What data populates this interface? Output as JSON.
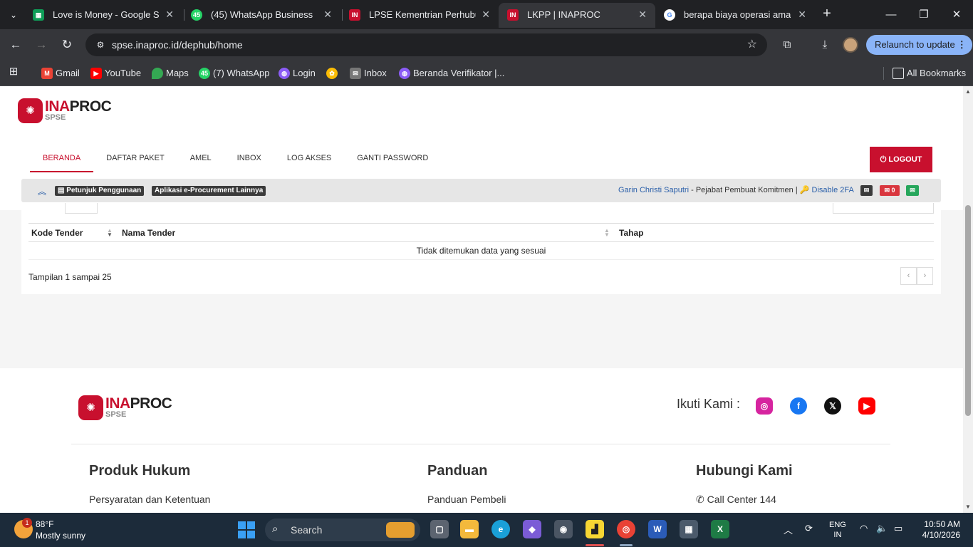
{
  "browser": {
    "tabs": [
      {
        "title": "Love is Money - Google Spre",
        "favicon": "sheets-icon",
        "color": "#0f9d58"
      },
      {
        "title": "(45) WhatsApp Business",
        "favicon": "whatsapp-icon",
        "color": "#25d366",
        "badge": "45"
      },
      {
        "title": "LPSE Kementrian Perhubung",
        "favicon": "inaproc-icon",
        "color": "#c8102e"
      },
      {
        "title": "LKPP | INAPROC",
        "favicon": "inaproc-icon",
        "color": "#c8102e"
      },
      {
        "title": "berapa biaya operasi amand",
        "favicon": "google-icon",
        "color": "#4285f4"
      }
    ],
    "url": "spse.inaproc.id/dephub/home",
    "relaunch_label": "Relaunch to update",
    "bookmarks": [
      {
        "label": "Gmail",
        "icon": "gmail-icon",
        "color": "#ea4335"
      },
      {
        "label": "YouTube",
        "icon": "youtube-icon",
        "color": "#ff0000"
      },
      {
        "label": "Maps",
        "icon": "maps-icon",
        "color": "#34a853"
      },
      {
        "label": "(7) WhatsApp",
        "icon": "whatsapp-icon",
        "color": "#25d366",
        "badge": "45"
      },
      {
        "label": "Login",
        "icon": "globe-icon",
        "color": "#8b5cf6"
      },
      {
        "label": "",
        "icon": "photos-icon",
        "color": "#fbbc05"
      },
      {
        "label": "Inbox",
        "icon": "mail-icon",
        "color": "#777777"
      },
      {
        "label": "Beranda Verifikator |...",
        "icon": "globe-icon",
        "color": "#8b5cf6"
      }
    ],
    "all_bookmarks": "All Bookmarks"
  },
  "site": {
    "logo": {
      "accent": "INA",
      "rest": "PROC",
      "sub": "SPSE"
    },
    "menu": [
      "BERANDA",
      "DAFTAR PAKET",
      "AMEL",
      "INBOX",
      "LOG AKSES",
      "GANTI PASSWORD"
    ],
    "logout": "LOGOUT",
    "infobar": {
      "guide": "Petunjuk Penggunaan",
      "other_apps": "Aplikasi e-Procurement Lainnya",
      "user_name": "Garin Christi Saputri",
      "role": " - Pejabat Pembuat Komitmen | ",
      "disable_2fa": "Disable 2FA",
      "inbox_count": "0"
    },
    "table": {
      "columns": [
        "Kode Tender",
        "Nama Tender",
        "Tahap"
      ],
      "empty_message": "Tidak ditemukan data yang sesuai",
      "count_text": "Tampilan 1 sampai 25",
      "prev": "‹",
      "next": "›"
    },
    "footer": {
      "follow_label": "Ikuti Kami :",
      "columns": [
        {
          "title": "Produk Hukum",
          "link": "Persyaratan dan Ketentuan"
        },
        {
          "title": "Panduan",
          "link": "Panduan Pembeli"
        },
        {
          "title": "Hubungi Kami",
          "link": "Call Center 144"
        }
      ]
    }
  },
  "taskbar": {
    "temperature": "88°F",
    "weather": "Mostly sunny",
    "weather_badge": "1",
    "search_placeholder": "Search",
    "language": "ENG",
    "region": "IN",
    "time": "10:50 AM",
    "date": "4/10/2026"
  }
}
